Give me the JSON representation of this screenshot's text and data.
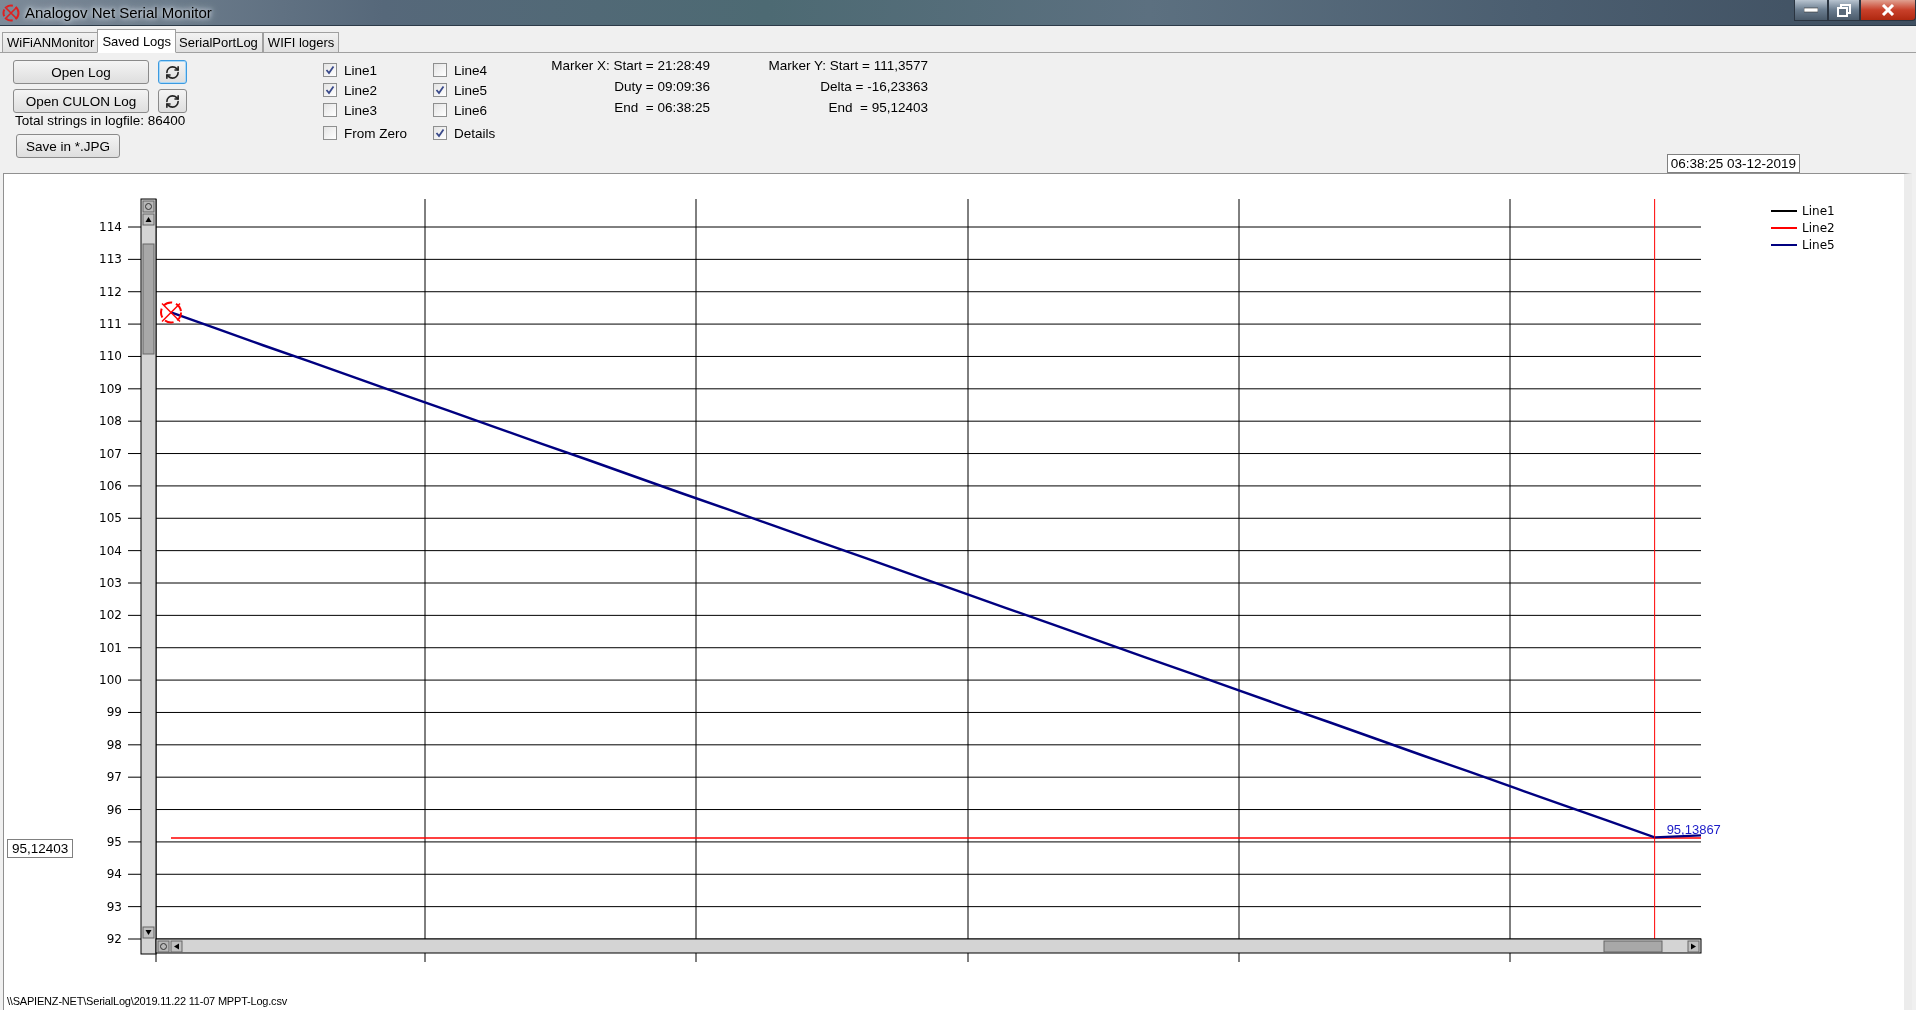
{
  "window": {
    "title": "Analogov Net Serial Monitor"
  },
  "tabs": [
    {
      "label": "WiFiANMonitor",
      "selected": false
    },
    {
      "label": "Saved Logs",
      "selected": true
    },
    {
      "label": "SerialPortLog",
      "selected": false
    },
    {
      "label": "WIFI logers",
      "selected": false
    }
  ],
  "log_buttons": [
    {
      "label": "Open Log",
      "refresh_focused": true
    },
    {
      "label": "Open CULON Log",
      "refresh_focused": false
    }
  ],
  "total_strings": "Total strings in logfile: 86400",
  "save_button": "Save in *.JPG",
  "checkbox_columns": [
    [
      {
        "label": "Line1",
        "checked": true
      },
      {
        "label": "Line2",
        "checked": true
      },
      {
        "label": "Line3",
        "checked": false
      },
      {
        "label": "From Zero",
        "checked": false
      }
    ],
    [
      {
        "label": "Line4",
        "checked": false
      },
      {
        "label": "Line5",
        "checked": true
      },
      {
        "label": "Line6",
        "checked": false
      },
      {
        "label": "Details",
        "checked": true
      }
    ]
  ],
  "marker_x": [
    "Marker X: Start = 21:28:49",
    "Duty = 09:09:36",
    "End  = 06:38:25"
  ],
  "marker_y": [
    "Marker Y: Start = 111,3577",
    "Delta = -16,23363",
    "End  = 95,12403"
  ],
  "time_box": "06:38:25 03-12-2019",
  "value_box": "95,12403",
  "chart": {
    "point_label": "95,13867",
    "chart_data": {
      "type": "line",
      "legend": "right",
      "categories": [
        null,
        null,
        null,
        null,
        null,
        null,
        null,
        null,
        null,
        null,
        null,
        null,
        null,
        null,
        null,
        null,
        null,
        null,
        null,
        null,
        null,
        null,
        null,
        null,
        null,
        null,
        null,
        null,
        null,
        null,
        null,
        null,
        null,
        null
      ],
      "ylim": [
        92,
        114
      ],
      "yticks": [
        92,
        93,
        94,
        95,
        96,
        97,
        98,
        99,
        100,
        101,
        102,
        103,
        104,
        105,
        106,
        107,
        108,
        109,
        110,
        111,
        112,
        113,
        114
      ],
      "series": [
        {
          "name": "Line1",
          "color": "#000000",
          "values": [
            null,
            null,
            null,
            null,
            null,
            null,
            null,
            null,
            null,
            null,
            null,
            null,
            null,
            null,
            null,
            null,
            null,
            null,
            null,
            null,
            null,
            null,
            null,
            null,
            null,
            null,
            null,
            null,
            null,
            null,
            null,
            null,
            null,
            null
          ]
        },
        {
          "name": "Line2",
          "color": "#ff0000",
          "values": [
            95.12,
            95.12,
            95.12,
            95.12,
            95.12,
            95.12,
            95.12,
            95.12,
            95.12,
            95.12,
            95.12,
            95.12,
            95.12,
            95.12,
            95.12,
            95.12,
            95.12,
            95.12,
            95.12,
            95.12,
            95.12,
            95.12,
            95.12,
            95.12,
            95.12,
            95.12,
            95.12,
            95.12,
            95.12,
            95.12,
            95.12,
            95.12,
            95.12,
            95.12
          ]
        },
        {
          "name": "Line5",
          "color": "#000080",
          "values": [
            111.36,
            110.85,
            110.34,
            109.84,
            109.33,
            108.82,
            108.32,
            107.81,
            107.3,
            106.8,
            106.29,
            105.78,
            105.28,
            104.77,
            104.26,
            103.76,
            103.25,
            102.74,
            102.23,
            101.73,
            101.22,
            100.71,
            100.21,
            99.7,
            99.19,
            98.69,
            98.18,
            97.67,
            97.17,
            96.66,
            96.15,
            95.65,
            95.14,
            95.2
          ]
        }
      ]
    }
  },
  "file_path": "\\\\SAPIENZ-NET\\SerialLog\\2019.11.22 11-07 MPPT-Log.csv"
}
